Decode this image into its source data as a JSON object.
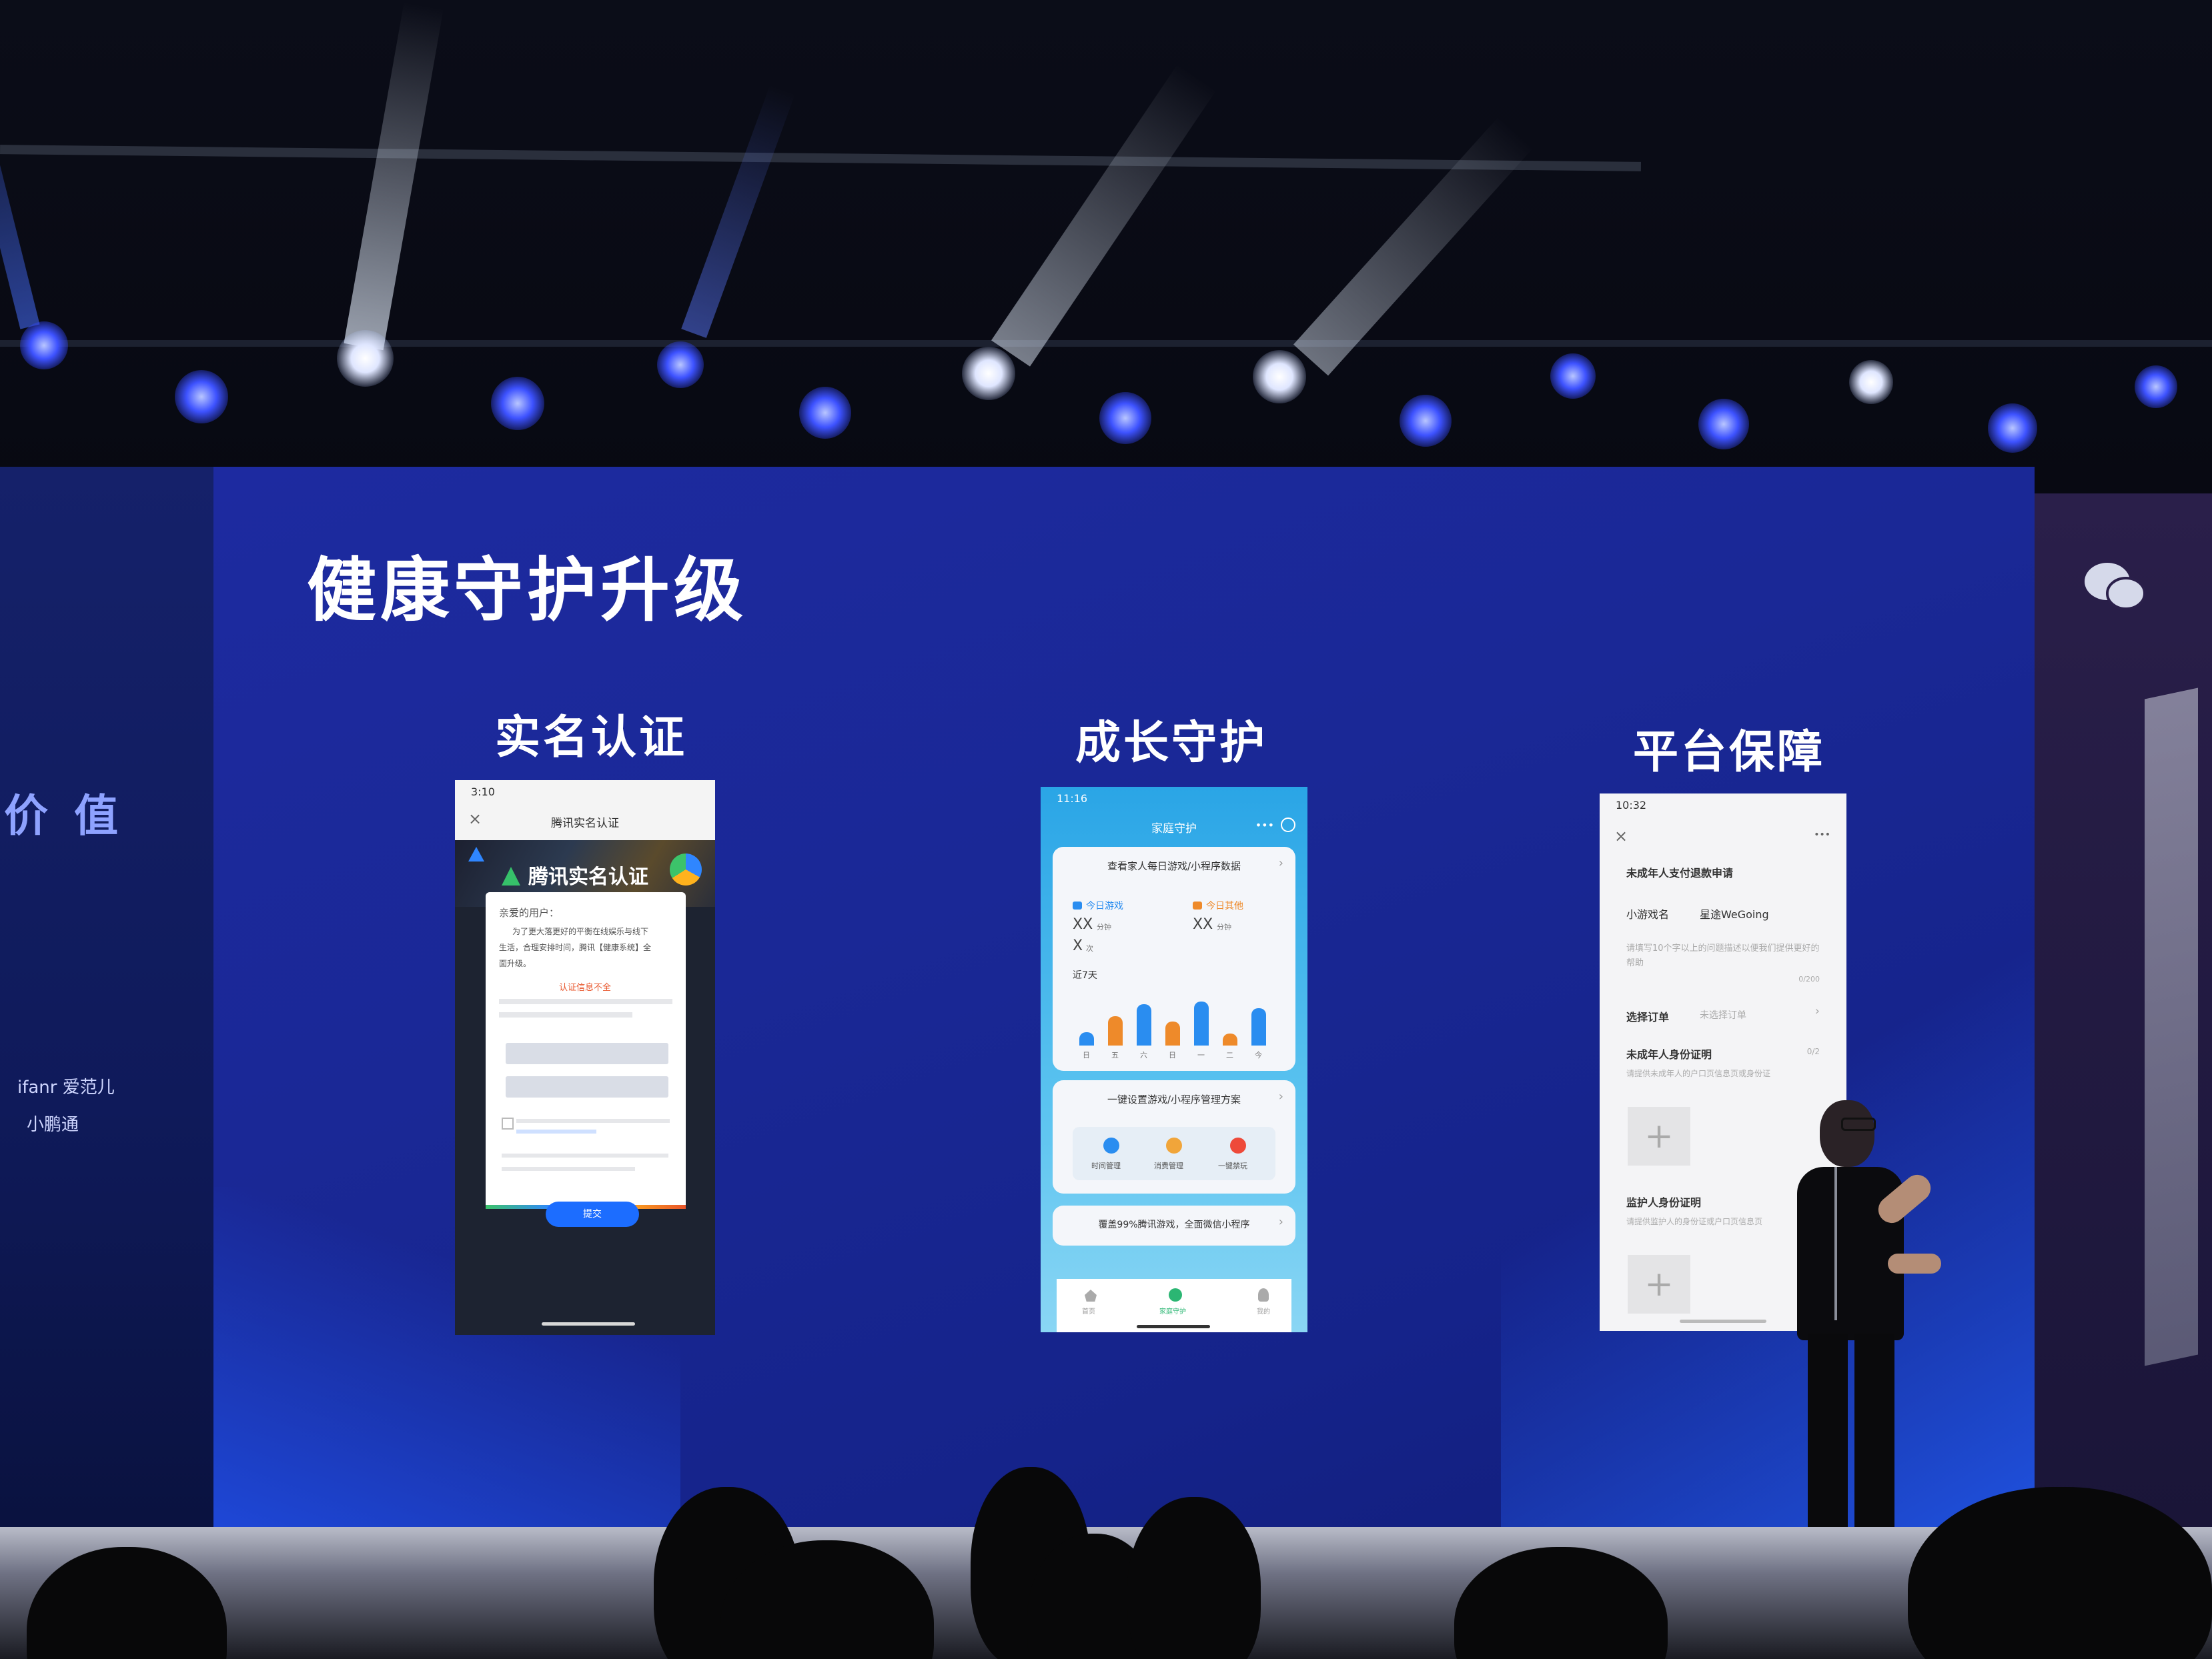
{
  "slide": {
    "title": "健康守护升级",
    "columns": [
      "实名认证",
      "成长守护",
      "平台保障"
    ]
  },
  "left_screen": {
    "partial_text": "价 值",
    "sponsors": [
      "ifanr 爱范儿",
      "小鹏通"
    ]
  },
  "phone_realname": {
    "time": "3:10",
    "nav_title": "腾讯实名认证",
    "banner": "腾讯实名认证",
    "greeting": "亲爱的用户：",
    "body_line1": "为了更大落更好的平衡在线娱乐与线下",
    "body_line2": "生活，合理安排时间，腾讯【健康系统】全",
    "body_line3": "面升级。",
    "warning": "认证信息不全",
    "confirm": "提交"
  },
  "phone_growth": {
    "time": "11:16",
    "nav_title": "家庭守护",
    "top_link": "查看家人每日游戏/小程序数据",
    "stat_left_label": "今日游戏",
    "stat_left_value": "XX",
    "stat_left_unit": "分钟",
    "stat_left_count": "X",
    "stat_left_count_unit": "次",
    "stat_right_label": "今日其他",
    "stat_right_value": "XX",
    "stat_right_unit": "分钟",
    "recent_label": "近7天",
    "days": [
      "日",
      "五",
      "六",
      "日",
      "一",
      "二",
      "今"
    ],
    "plan_link": "一键设置游戏/小程序管理方案",
    "actions": [
      "时间管理",
      "消费管理",
      "一键禁玩"
    ],
    "coverage_link": "覆盖99%腾讯游戏，全面微信小程序",
    "tabs": [
      "首页",
      "家庭守护",
      "我的"
    ]
  },
  "phone_platform": {
    "time": "10:32",
    "header": "未成年人支付退款申请",
    "game_name_label": "小游戏名",
    "game_name_value": "星途WeGoing",
    "reason_placeholder": "请填写10个字以上的问题描述以便我们提供更好的帮助",
    "counter_a": "0/200",
    "order_label": "选择订单",
    "order_value": "未选择订单",
    "minor_id_label": "未成年人身份证明",
    "minor_id_count": "0/2",
    "minor_id_hint": "请提供未成年人的户口页信息页或身份证",
    "guardian_id_label": "监护人身份证明",
    "guardian_id_hint": "请提供监护人的身份证或户口页信息页"
  }
}
